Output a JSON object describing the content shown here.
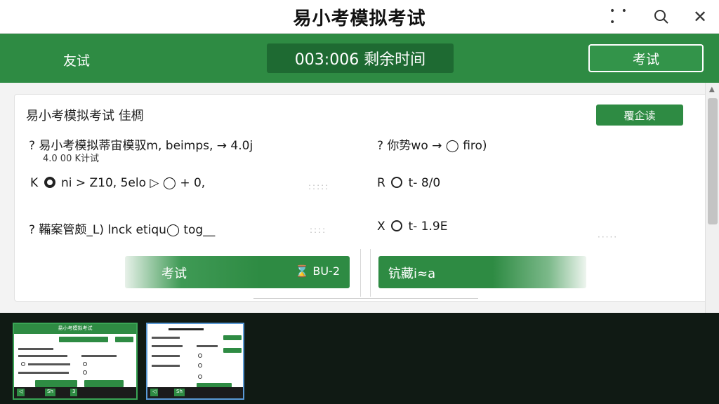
{
  "window": {
    "title": "易小考模拟考试",
    "controls": {
      "more": "• • •",
      "search": "⌕",
      "close": "✕"
    }
  },
  "header": {
    "left_label": "友试",
    "timer": "003:006 剩余时间",
    "action_label": "考试"
  },
  "card": {
    "title": "易小考模拟考试 佳椆",
    "badge": "覆企读",
    "questions": {
      "q1": "? 易小考模拟蒂宙模驭m, beimps, → 4.0j",
      "q1_sub": "4.0 00 K计试",
      "q2": "? 你势wo → ◯ firo)",
      "q3": "? 鞴案管颇_L) lnck etiqu◯ tog__",
      "opt_k": "ni > Z10, 5elo ▷ ◯ + 0,",
      "opt_k_prefix": "K",
      "opt_r_prefix": "R",
      "opt_r": "t- 8/0",
      "opt_x_prefix": "X",
      "opt_x": "t- 1.9E"
    },
    "action_left": {
      "label": "考试",
      "right": "BU-2"
    },
    "action_right": {
      "label": "钪藏i≈a"
    }
  },
  "filmstrip": {
    "thumb1_title": "易小考模拟考试",
    "thumb1_footer": [
      "◁",
      "Sh",
      "3"
    ],
    "thumb2_footer": [
      "◁",
      "Sh"
    ]
  },
  "colors": {
    "brand_green": "#2e8b43",
    "dark_green": "#1e6a32",
    "filmstrip_bg": "#101a14"
  },
  "icons": [
    "more-icon",
    "search-icon",
    "close-icon",
    "radio-icon",
    "clock-icon",
    "scroll-up-icon"
  ]
}
